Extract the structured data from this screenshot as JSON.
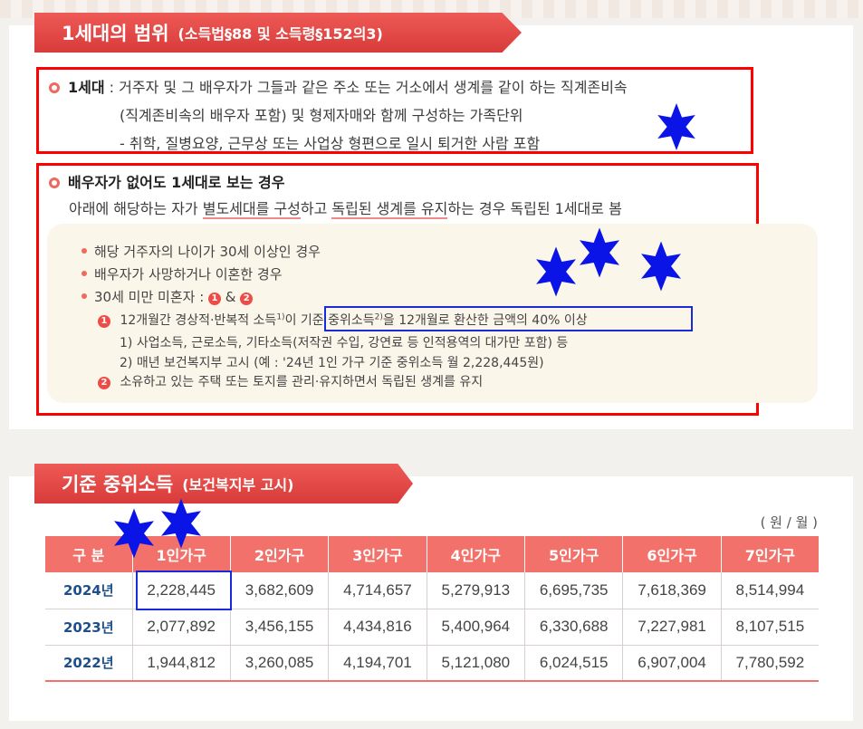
{
  "section1": {
    "title": "1세대의 범위",
    "subtitle": "(소득법§88 및 소득령§152의3)",
    "def_term": "1세대",
    "def_line1": " : 거주자 및 그 배우자가 그들과 같은 주소 또는 거소에서 생계를 같이 하는 직계존비속",
    "def_line2": "(직계존비속의 배우자 포함) 및 형제자매와 함께 구성하는 가족단위",
    "def_line3": "-  취학, 질병요양, 근무상 또는 사업상 형편으로 일시 퇴거한 사람 포함",
    "exception_title": "배우자가 없어도 1세대로 보는 경우",
    "exception_a": "아래에 해당하는 자가 ",
    "exception_u1": "별도세대를 구성",
    "exception_b": "하고 ",
    "exception_u2": "독립된 생계를 유지",
    "exception_c": "하는 경우 독립된 1세대로 봄",
    "bullets": [
      "해당 거주자의 나이가 30세 이상인 경우",
      "배우자가 사망하거나 이혼한 경우",
      "30세 미만 미혼자 : "
    ],
    "circled1": "1",
    "circled2": "2",
    "amp": " & ",
    "sub1a": "12개월간 경상적·반복적 소득",
    "sup1": "1)",
    "sub1b": "이 ",
    "sub1c": "기준 중위소득",
    "sup2": "2)",
    "sub1d": "을 12개월로 환산한 금액의 40% 이상",
    "note1": "1)  사업소득, 근로소득, 기타소득(저작권 수입, 강연료 등 인적용역의 대가만 포함) 등",
    "note2": "2)  매년 보건복지부 고시 (예 : '24년 1인 가구 기준 중위소득 월 2,228,445원)",
    "sub2": "소유하고 있는 주택 또는 토지를 관리·유지하면서 독립된 생계를 유지"
  },
  "section2": {
    "title": "기준 중위소득",
    "subtitle": "(보건복지부 고시)",
    "unit": "( 원 / 월 )",
    "headers": [
      "구 분",
      "1인가구",
      "2인가구",
      "3인가구",
      "4인가구",
      "5인가구",
      "6인가구",
      "7인가구"
    ],
    "rows": [
      {
        "year": "2024년",
        "values": [
          "2,228,445",
          "3,682,609",
          "4,714,657",
          "5,279,913",
          "6,695,735",
          "7,618,369",
          "8,514,994"
        ]
      },
      {
        "year": "2023년",
        "values": [
          "2,077,892",
          "3,456,155",
          "4,434,816",
          "5,400,964",
          "6,330,688",
          "7,227,981",
          "8,107,515"
        ]
      },
      {
        "year": "2022년",
        "values": [
          "1,944,812",
          "3,260,085",
          "4,194,701",
          "5,121,080",
          "6,024,515",
          "6,907,004",
          "7,780,592"
        ]
      }
    ]
  },
  "colors": {
    "banner": "#e0403e",
    "annotation_red": "#ff0000",
    "annotation_blue": "#0a14e6",
    "year_text": "#1d4f8c"
  },
  "icons": [
    "star-icon"
  ]
}
